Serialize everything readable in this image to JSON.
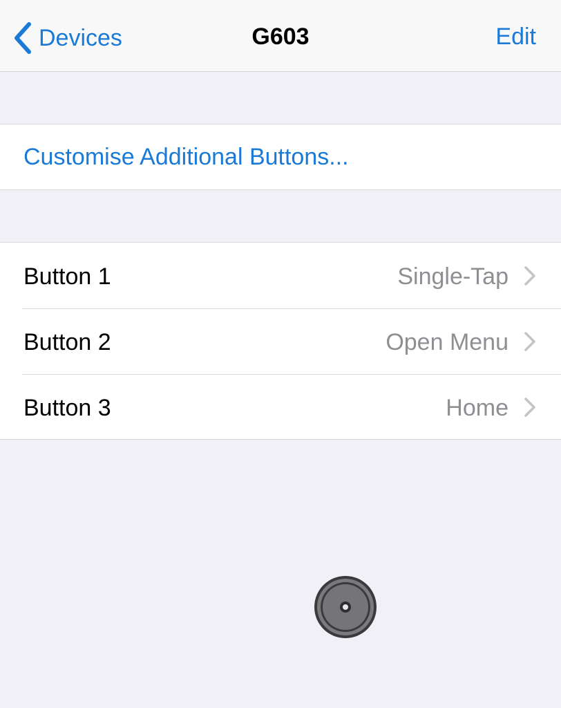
{
  "navbar": {
    "back_label": "Devices",
    "title": "G603",
    "edit_label": "Edit"
  },
  "customise": {
    "label": "Customise Additional Buttons..."
  },
  "buttons": [
    {
      "label": "Button 1",
      "value": "Single-Tap"
    },
    {
      "label": "Button 2",
      "value": "Open Menu"
    },
    {
      "label": "Button 3",
      "value": "Home"
    }
  ],
  "icons": {
    "back": "chevron-left-icon",
    "row_chevron": "chevron-right-icon",
    "assistive_touch": "assistive-touch-icon"
  },
  "colors": {
    "accent": "#1a7ad6",
    "background": "#f1f0f6",
    "secondary_text": "#8e8e93"
  }
}
